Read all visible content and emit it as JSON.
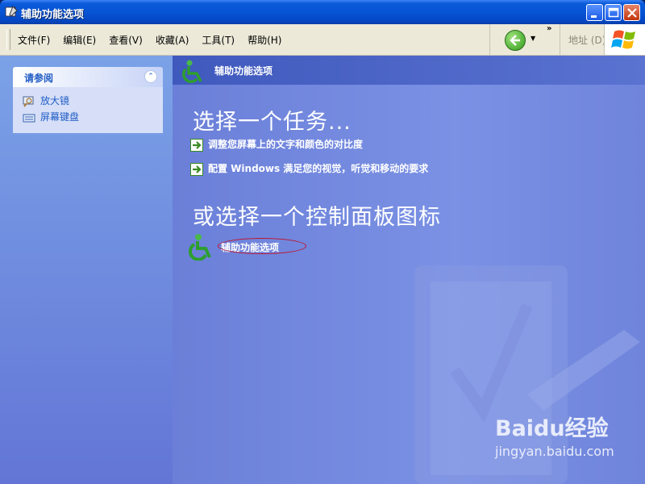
{
  "window": {
    "title": "辅助功能选项"
  },
  "menu": [
    {
      "label": "文件(F)"
    },
    {
      "label": "编辑(E)"
    },
    {
      "label": "查看(V)"
    },
    {
      "label": "收藏(A)"
    },
    {
      "label": "工具(T)"
    },
    {
      "label": "帮助(H)"
    }
  ],
  "toolbar": {
    "chevron": "»",
    "address_label": "地址 (D)"
  },
  "see_also": {
    "title": "请参阅",
    "links": [
      {
        "label": "放大镜",
        "icon": "magnifier-icon"
      },
      {
        "label": "屏幕键盘",
        "icon": "keyboard-icon"
      }
    ]
  },
  "main": {
    "header_title": "辅助功能选项",
    "pick_task_title": "选择一个任务...",
    "tasks": [
      {
        "label": "调整您屏幕上的文字和颜色的对比度"
      },
      {
        "label": "配置 Windows 满足您的视觉，听觉和移动的要求"
      }
    ],
    "pick_icon_title": "或选择一个控制面板图标",
    "control_panel_item": {
      "label": "辅助功能选项",
      "icon": "accessibility-icon"
    }
  },
  "watermark": {
    "logo_text": "Baidu经验",
    "url": "jingyan.baidu.com"
  },
  "colors": {
    "accent": "#215dc6",
    "titlebar": "#0654d6",
    "content_bg": "#7a91e4"
  }
}
